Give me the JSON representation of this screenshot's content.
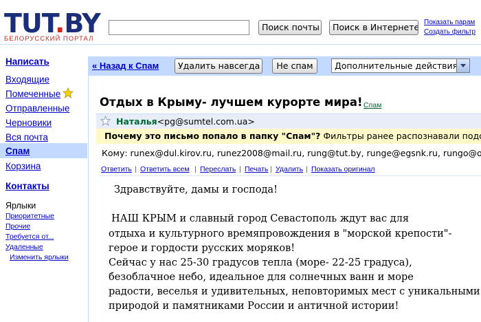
{
  "header": {
    "logo_main": "TUT",
    "logo_dot": ".",
    "logo_tail": "BY",
    "logo_sub": "БЕЛОРУССКИЙ ПОРТАЛ",
    "search_mail": "Поиск почты",
    "search_web": "Поиск в Интернете",
    "link_options": "Показать парам",
    "link_filter": "Создать фильтр"
  },
  "sidebar": {
    "compose": "Написать",
    "items": [
      "Входящие",
      "Помеченные",
      "Отправленные",
      "Черновики",
      "Вся почта",
      "Спам",
      "Корзина"
    ],
    "contacts": "Контакты",
    "labels_title": "Ярлыки",
    "labels": [
      "Приоритетные",
      "Прочие",
      "Требуется от...",
      "Удаленные"
    ],
    "edit_labels": "Изменить ярлыки"
  },
  "toolbar": {
    "back": "« Назад к Спам",
    "delete_forever": "Удалить навсегда",
    "not_spam": "Не спам",
    "more_actions": "Дополнительные действия..."
  },
  "message": {
    "subject": "Отдых в Крыму- лучшем курорте мира!",
    "label": "Спам",
    "sender_name": "Наталья",
    "sender_email": "<pg@sumtel.com.ua>",
    "spam_question": "Почему это письмо попало в папку \"Спам\"?",
    "spam_explain": "Фильтры ранее распознавали подобны",
    "to_label": "Кому:",
    "to_list": "runex@dul.kirov.ru, runez2008@mail.ru, rung@tut.by, runge@egsnk.ru, rungo@ogo.i",
    "actions": [
      "Ответить",
      "Ответить всем",
      "Переслать",
      "Печать",
      "Удалить",
      "Показать оригинал"
    ],
    "body": [
      "Здравствуйте, дамы и господа!",
      "НАШ КРЫМ и славный город Севастополь ждут вас для",
      "отдыха и культурного времяпровождения в \"морской крепости\"-",
      "герое и гордости русских моряков!",
      " Сейчас у нас 25-30 градусов тепла (море- 22-25 градуса),",
      "безоблачное небо, идеальное для солнечных ванн и море",
      "радости, веселья и удивительных, неповторимых мест с уникальными",
      "природой и памятниками России и античной истории!"
    ]
  },
  "colors": {
    "accent_blue": "#c3d9ff",
    "link": "#0000cc",
    "logo_red": "#d12a1c",
    "logo_blue": "#1a2e7a",
    "spam_notice_bg": "#fff8c8",
    "sender_green": "#006633"
  }
}
